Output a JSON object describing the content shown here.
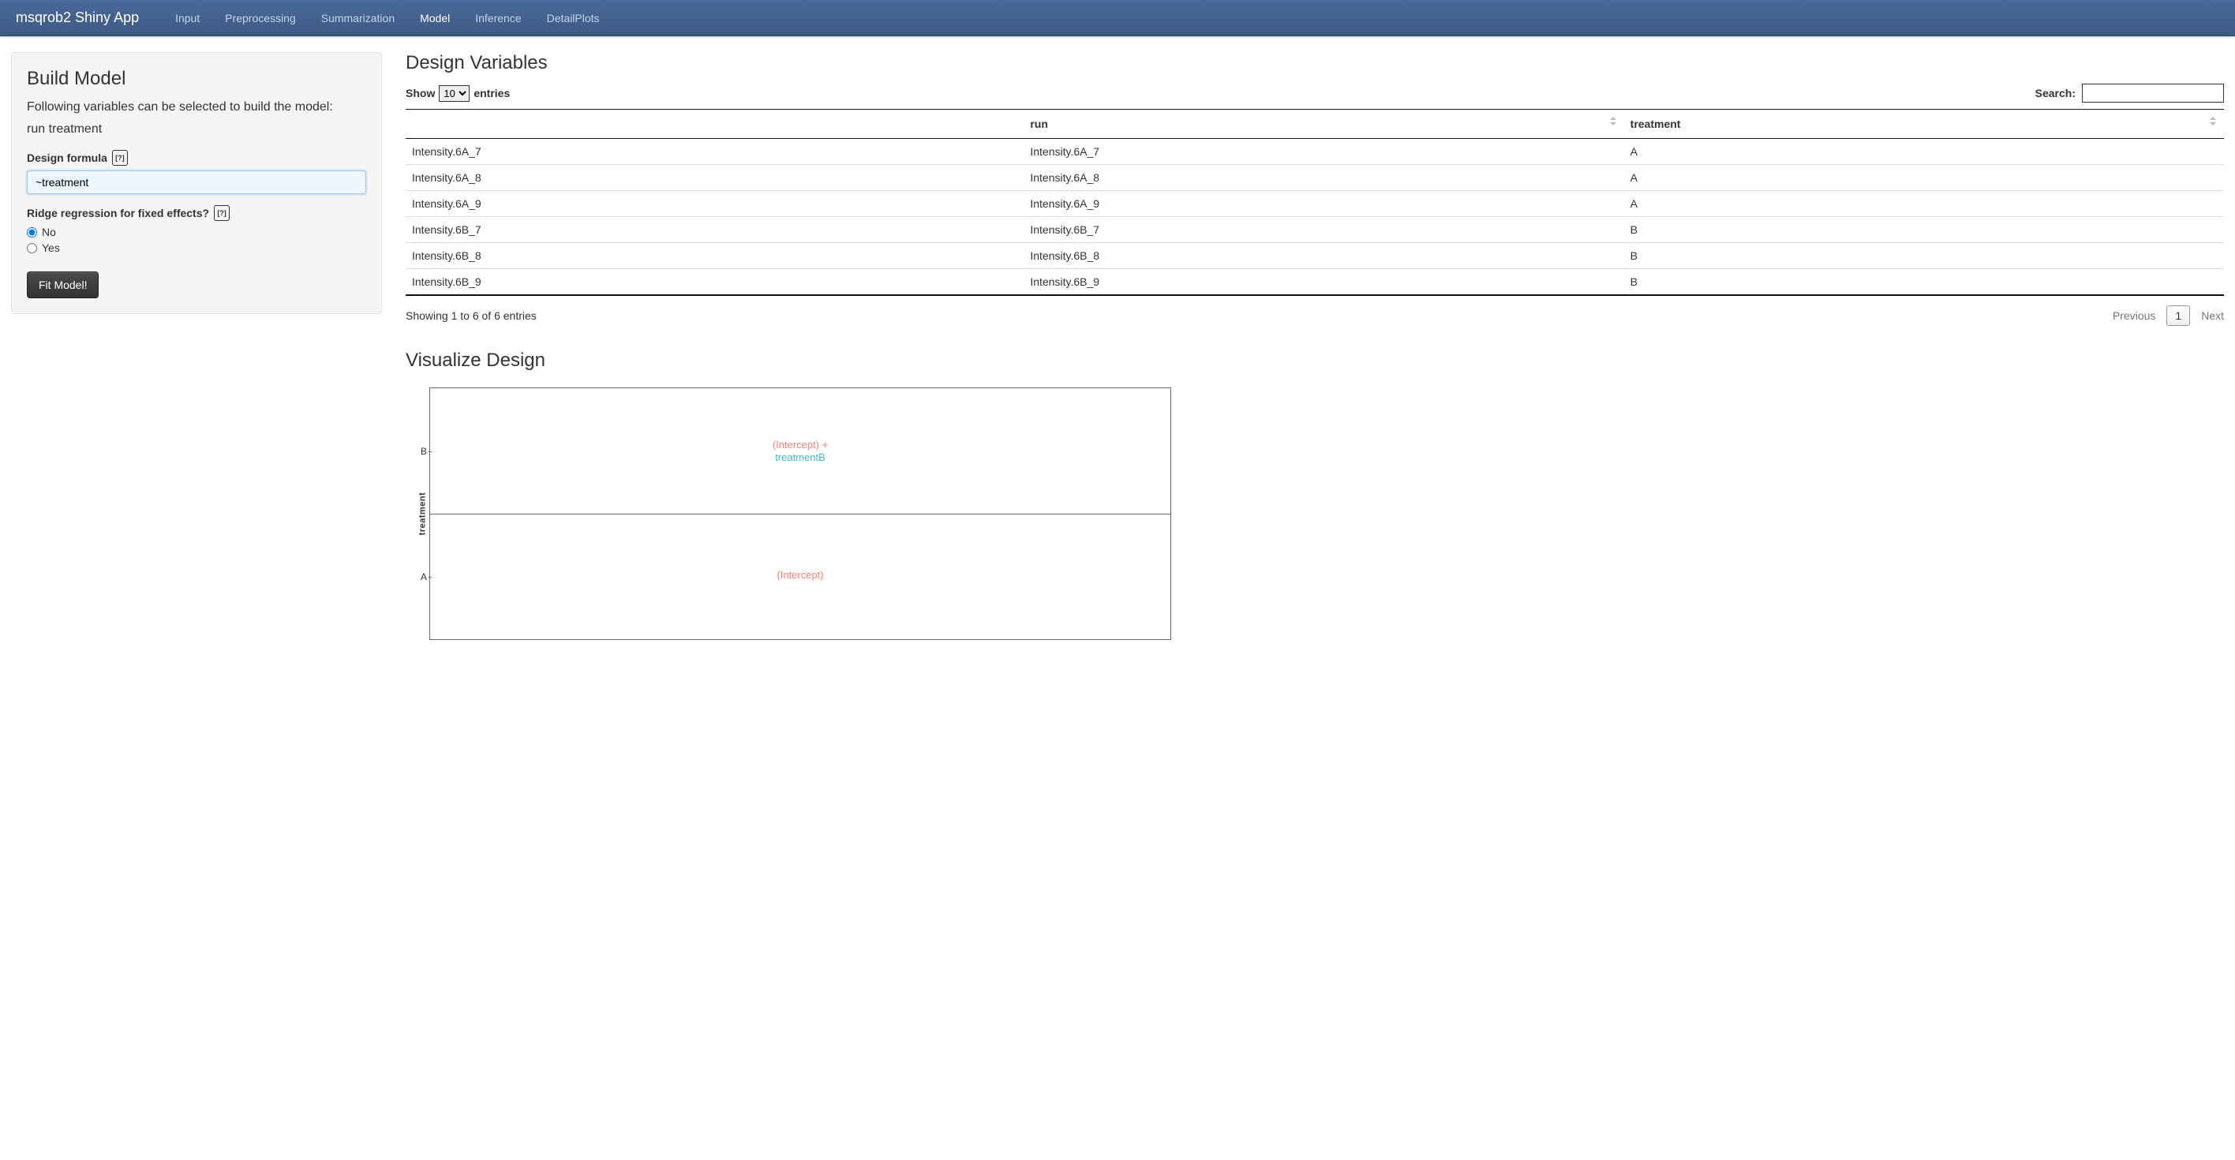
{
  "nav": {
    "brand": "msqrob2 Shiny App",
    "items": [
      "Input",
      "Preprocessing",
      "Summarization",
      "Model",
      "Inference",
      "DetailPlots"
    ],
    "active": "Model"
  },
  "sidebar": {
    "title": "Build Model",
    "desc_line1": "Following variables can be selected to build the model:",
    "desc_line2": "run treatment",
    "formula_label": "Design formula",
    "formula_value": "~treatment",
    "ridge_label": "Ridge regression for fixed effects?",
    "ridge_options": [
      "No",
      "Yes"
    ],
    "ridge_selected": "No",
    "fit_button": "Fit Model!",
    "help_symbol": "[?]"
  },
  "design_vars": {
    "title": "Design Variables",
    "show_label_pre": "Show",
    "show_label_post": "entries",
    "show_value": "10",
    "search_label": "Search:",
    "search_value": "",
    "columns": [
      "",
      "run",
      "treatment"
    ],
    "rows": [
      {
        "id": "Intensity.6A_7",
        "run": "Intensity.6A_7",
        "treatment": "A"
      },
      {
        "id": "Intensity.6A_8",
        "run": "Intensity.6A_8",
        "treatment": "A"
      },
      {
        "id": "Intensity.6A_9",
        "run": "Intensity.6A_9",
        "treatment": "A"
      },
      {
        "id": "Intensity.6B_7",
        "run": "Intensity.6B_7",
        "treatment": "B"
      },
      {
        "id": "Intensity.6B_8",
        "run": "Intensity.6B_8",
        "treatment": "B"
      },
      {
        "id": "Intensity.6B_9",
        "run": "Intensity.6B_9",
        "treatment": "B"
      }
    ],
    "footer_info": "Showing 1 to 6 of 6 entries",
    "prev": "Previous",
    "next": "Next",
    "page": "1"
  },
  "viz": {
    "title": "Visualize Design",
    "ylabel": "treatment",
    "y_ticks": [
      "B",
      "A"
    ],
    "cell_top_line1": "(Intercept) +",
    "cell_top_line2": "treatmentB",
    "cell_bottom": "(Intercept)"
  },
  "chart_data": {
    "type": "table",
    "title": "Visualize Design",
    "ylabel": "treatment",
    "rows": [
      {
        "treatment": "B",
        "terms": [
          "(Intercept)",
          "treatmentB"
        ]
      },
      {
        "treatment": "A",
        "terms": [
          "(Intercept)"
        ]
      }
    ]
  }
}
